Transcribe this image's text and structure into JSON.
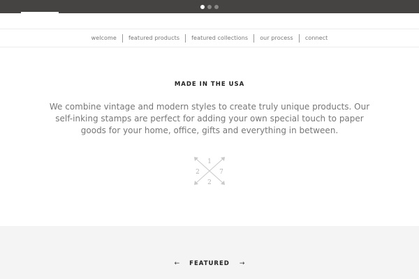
{
  "slider": {
    "slide_count": 3,
    "active_index": 0
  },
  "nav": {
    "items": [
      {
        "label": "welcome"
      },
      {
        "label": "featured products"
      },
      {
        "label": "featured collections"
      },
      {
        "label": "our process"
      },
      {
        "label": "connect"
      }
    ]
  },
  "intro": {
    "heading": "MADE IN THE USA",
    "body": "We combine vintage and modern styles to create truly unique products.  Our self-inking stamps are perfect for adding your own special touch to paper goods for your home, office, gifts and everything in between."
  },
  "logo": {
    "numbers": [
      "1",
      "2",
      "7",
      "2"
    ]
  },
  "featured": {
    "title": "FEATURED",
    "prev_icon": "arrow-left-icon",
    "next_icon": "arrow-right-icon"
  },
  "colors": {
    "hero_bg": "#464442",
    "text_muted": "#777777",
    "band_bg": "#f4f4f4"
  }
}
